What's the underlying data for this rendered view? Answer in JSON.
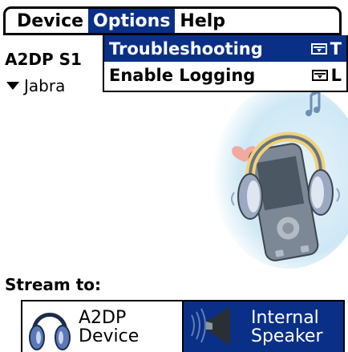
{
  "menubar": {
    "items": [
      "Device",
      "Options",
      "Help"
    ],
    "active": "Options"
  },
  "dropdown": {
    "items": [
      {
        "label": "Troubleshooting",
        "shortcut": "T"
      },
      {
        "label": "Enable Logging",
        "shortcut": "L"
      }
    ]
  },
  "screen": {
    "title": "A2DP S1",
    "device_value": "Jabra"
  },
  "stream": {
    "label": "Stream to:",
    "options": [
      {
        "line1": "A2DP",
        "line2": "Device"
      },
      {
        "line1": "Internal",
        "line2": "Speaker"
      }
    ],
    "selected": "Internal Speaker"
  },
  "colors": {
    "highlight": "#0a2f86",
    "illustration_sky": "#cfe8f5"
  }
}
